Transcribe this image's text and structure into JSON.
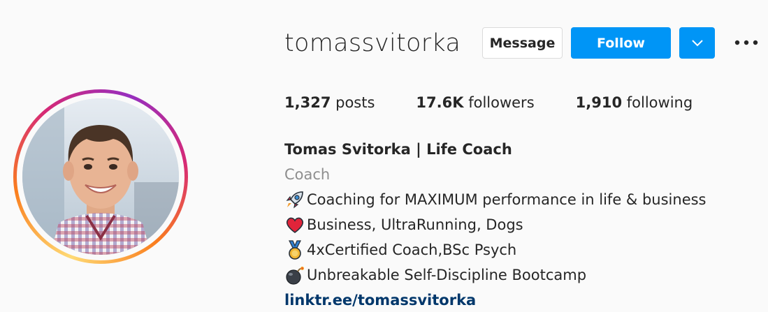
{
  "profile": {
    "username": "tomassvitorka",
    "display_name": "Tomas Svitorka | Life Coach",
    "category": "Coach",
    "bio_lines": [
      {
        "icon": "rocket-icon",
        "text": "Coaching for MAXIMUM performance in life & business"
      },
      {
        "icon": "red-heart-icon",
        "text": "Business, UltraRunning, Dogs"
      },
      {
        "icon": "medal-icon",
        "text": "4xCertified Coach,BSc Psych"
      },
      {
        "icon": "bomb-icon",
        "text": "Unbreakable Self-Discipline Bootcamp"
      }
    ],
    "link": "linktr.ee/tomassvitorka"
  },
  "actions": {
    "message_label": "Message",
    "follow_label": "Follow",
    "dropdown_icon": "chevron-down-icon",
    "more_icon": "more-options-icon"
  },
  "stats": {
    "posts_count": "1,327",
    "posts_label": "posts",
    "followers_count": "17.6K",
    "followers_label": "followers",
    "following_count": "1,910",
    "following_label": "following"
  },
  "colors": {
    "follow_blue": "#0095f6",
    "link_blue": "#00376b",
    "text": "#262626",
    "secondary_text": "#8e8e8e",
    "background": "#fafafa"
  }
}
